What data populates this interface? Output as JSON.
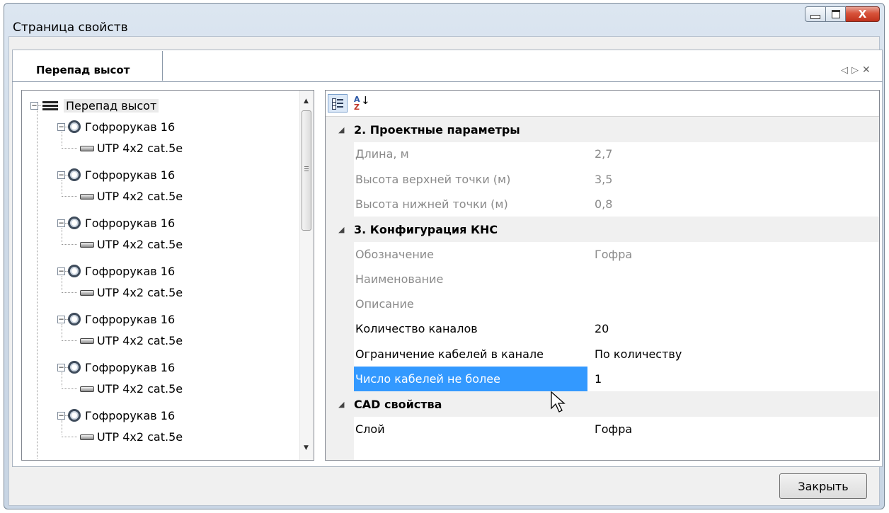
{
  "window": {
    "title": "Страница свойств",
    "controls": {
      "minimize_icon": "minimize-icon",
      "maximize_icon": "maximize-icon",
      "close_glyph": "X"
    }
  },
  "tabs": [
    {
      "label": "Перепад высот",
      "active": true
    }
  ],
  "tab_nav": {
    "prev_glyph": "◁",
    "next_glyph": "▷",
    "close_glyph": "✕"
  },
  "tree": {
    "root": {
      "label": "Перепад высот",
      "icon": "elevation-drop-icon"
    },
    "items": [
      {
        "label": "Гофрорукав 16",
        "icon": "corrugated-tube-icon",
        "child": {
          "label": "UTP 4x2 cat.5e",
          "icon": "cable-icon"
        }
      },
      {
        "label": "Гофрорукав 16",
        "icon": "corrugated-tube-icon",
        "child": {
          "label": "UTP 4x2 cat.5e",
          "icon": "cable-icon"
        }
      },
      {
        "label": "Гофрорукав 16",
        "icon": "corrugated-tube-icon",
        "child": {
          "label": "UTP 4x2 cat.5e",
          "icon": "cable-icon"
        }
      },
      {
        "label": "Гофрорукав 16",
        "icon": "corrugated-tube-icon",
        "child": {
          "label": "UTP 4x2 cat.5e",
          "icon": "cable-icon"
        }
      },
      {
        "label": "Гофрорукав 16",
        "icon": "corrugated-tube-icon",
        "child": {
          "label": "UTP 4x2 cat.5e",
          "icon": "cable-icon"
        }
      },
      {
        "label": "Гофрорукав 16",
        "icon": "corrugated-tube-icon",
        "child": {
          "label": "UTP 4x2 cat.5e",
          "icon": "cable-icon"
        }
      },
      {
        "label": "Гофрорукав 16",
        "icon": "corrugated-tube-icon",
        "child": {
          "label": "UTP 4x2 cat.5e",
          "icon": "cable-icon"
        }
      }
    ]
  },
  "toolbar": {
    "categorized_icon": "categorized-view-icon",
    "alphabetical_icon": "sort-alphabetical-icon"
  },
  "property_grid": [
    {
      "type": "category",
      "label": "2. Проектные параметры"
    },
    {
      "type": "property",
      "name": "Длина, м",
      "value": "2,7",
      "readonly": true
    },
    {
      "type": "property",
      "name": "Высота верхней точки (м)",
      "value": "3,5",
      "readonly": true
    },
    {
      "type": "property",
      "name": "Высота нижней точки (м)",
      "value": "0,8",
      "readonly": true
    },
    {
      "type": "category",
      "label": "3. Конфигурация КНС"
    },
    {
      "type": "property",
      "name": "Обозначение",
      "value": "Гофра",
      "readonly": true
    },
    {
      "type": "property",
      "name": "Наименование",
      "value": "",
      "readonly": true
    },
    {
      "type": "property",
      "name": "Описание",
      "value": "",
      "readonly": true
    },
    {
      "type": "property",
      "name": "Количество каналов",
      "value": "20",
      "readonly": false
    },
    {
      "type": "property",
      "name": "Ограничение кабелей в канале",
      "value": "По количеству",
      "readonly": false
    },
    {
      "type": "property",
      "name": "Число кабелей не более",
      "value": "1",
      "readonly": false,
      "selected": true
    },
    {
      "type": "category",
      "label": "CAD свойства"
    },
    {
      "type": "property",
      "name": "Слой",
      "value": "Гофра",
      "readonly": false
    }
  ],
  "footer": {
    "close_label": "Закрыть"
  },
  "colors": {
    "selection": "#3399ff",
    "category_bg": "#f0f0f0",
    "readonly_text": "#8a8a8a"
  }
}
